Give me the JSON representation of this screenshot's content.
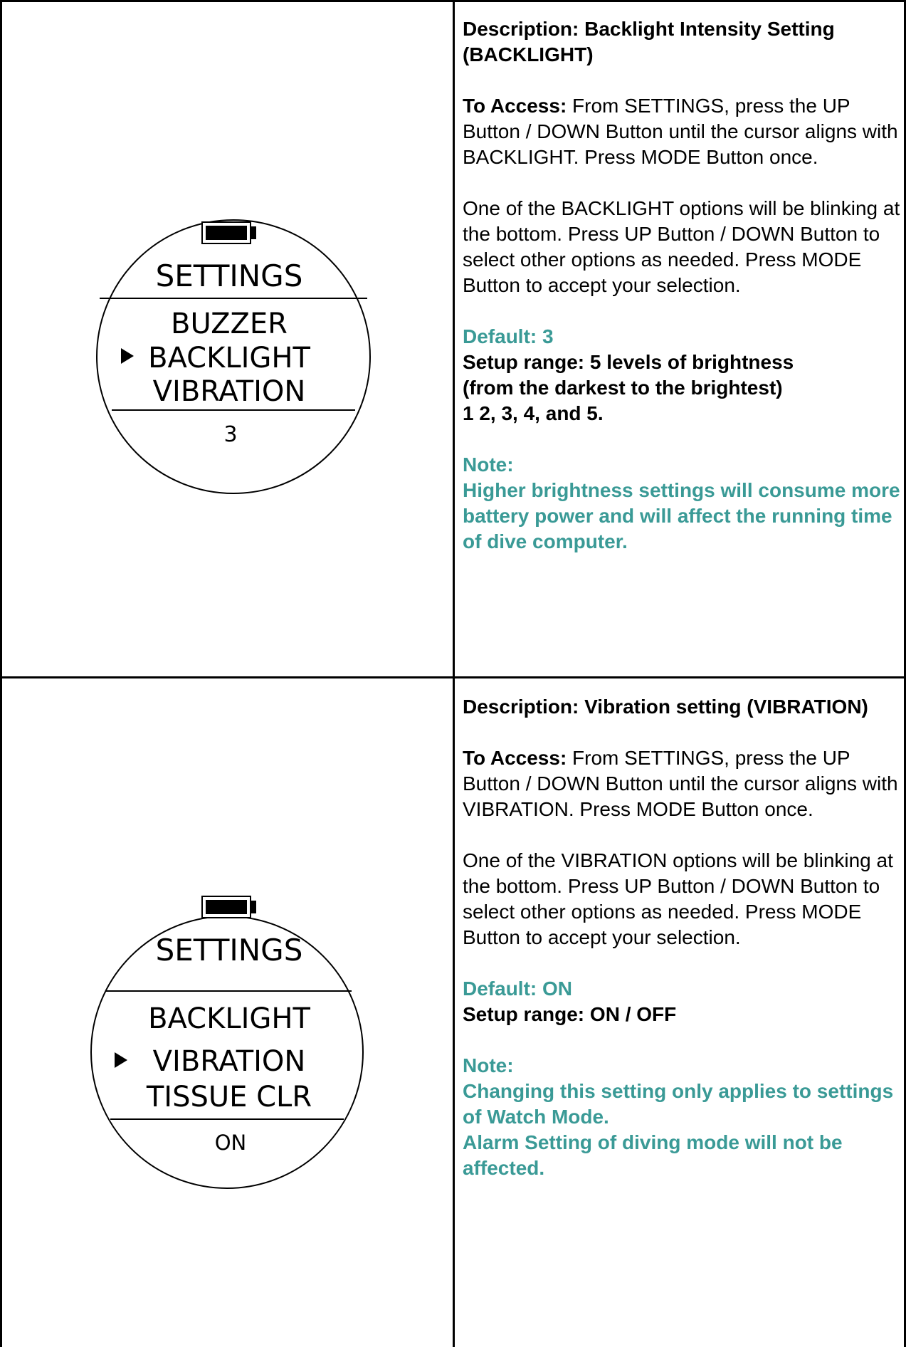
{
  "sections": [
    {
      "display": {
        "header": "SETTINGS",
        "items": [
          "BUZZER",
          "BACKLIGHT",
          "VIBRATION"
        ],
        "selected": "BACKLIGHT",
        "value": "3"
      },
      "title": "Description: Backlight Intensity Setting (BACKLIGHT)",
      "access_label": "To Access:",
      "access_text": " From SETTINGS, press the UP Button / DOWN Button until the cursor aligns with BACKLIGHT. Press MODE Button once.",
      "paragraph": "One of the BACKLIGHT options will be blinking at the bottom. Press UP Button / DOWN Button to select other options as needed. Press MODE Button to accept your selection.",
      "default": "Default: 3",
      "range_lines": [
        "Setup range: 5 levels of brightness",
        "(from the darkest to the brightest)",
        "1 2, 3, 4, and 5."
      ],
      "note_label": "Note:",
      "note_lines": [
        "Higher brightness settings will consume more battery power and will affect the running time of dive computer."
      ]
    },
    {
      "display": {
        "header": "SETTINGS",
        "items": [
          "BACKLIGHT",
          "VIBRATION",
          "TISSUE CLR"
        ],
        "selected": "VIBRATION",
        "value": "ON"
      },
      "title": "Description: Vibration setting (VIBRATION)",
      "access_label": "To Access:",
      "access_text": " From SETTINGS, press the UP Button / DOWN Button until the cursor aligns with VIBRATION. Press MODE Button once.",
      "paragraph": "One of the VIBRATION options will be blinking at the bottom. Press UP Button / DOWN Button to select other options as needed. Press MODE Button to accept your selection.",
      "default": "Default: ON",
      "range_lines": [
        "Setup range: ON / OFF"
      ],
      "note_label": "Note:",
      "note_lines": [
        "Changing this setting only applies to settings of Watch Mode.",
        "Alarm Setting of diving mode will not be affected."
      ]
    }
  ],
  "colors": {
    "accent": "#3a9a96",
    "border": "#000000"
  },
  "icons": {
    "battery": "battery-icon",
    "cursor": "cursor-arrow-icon"
  }
}
